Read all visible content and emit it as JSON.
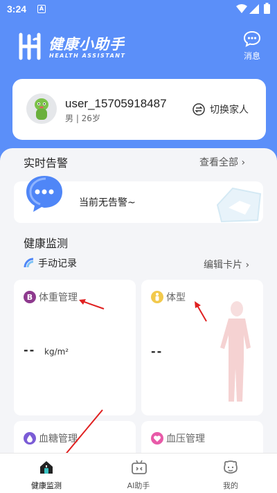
{
  "status": {
    "time": "3:24",
    "notif_letter": "A"
  },
  "brand": {
    "title": "健康小助手",
    "subtitle": "HEALTH ASSISTANT"
  },
  "header": {
    "message_label": "消息"
  },
  "user": {
    "name": "user_15705918487",
    "meta": "男 | 26岁",
    "switch_label": "切换家人"
  },
  "alerts": {
    "title": "实时告警",
    "view_all": "查看全部",
    "empty_text": "当前无告警~"
  },
  "monitor": {
    "title": "健康监测",
    "manual_record": "手动记录",
    "edit_cards": "编辑卡片",
    "cards": [
      {
        "title": "体重管理",
        "icon": "B",
        "value": "--",
        "unit": "kg/m²",
        "icon_color": "#8e3a8e"
      },
      {
        "title": "体型",
        "icon": "body-icon",
        "value": "--",
        "unit": "",
        "icon_color": "#f2c94c"
      },
      {
        "title": "血糖管理",
        "icon": "drop-icon",
        "value": "",
        "unit": "",
        "icon_color": "#7b5cd6"
      },
      {
        "title": "血压管理",
        "icon": "heart-icon",
        "value": "",
        "unit": "",
        "icon_color": "#e85aa8"
      }
    ]
  },
  "nav": [
    {
      "label": "健康监测",
      "icon": "home-icon",
      "active": true
    },
    {
      "label": "AI助手",
      "icon": "robot-icon",
      "active": false
    },
    {
      "label": "我的",
      "icon": "face-icon",
      "active": false
    }
  ],
  "colors": {
    "brand_blue": "#5b8ff9",
    "annotation_red": "#e02020"
  }
}
